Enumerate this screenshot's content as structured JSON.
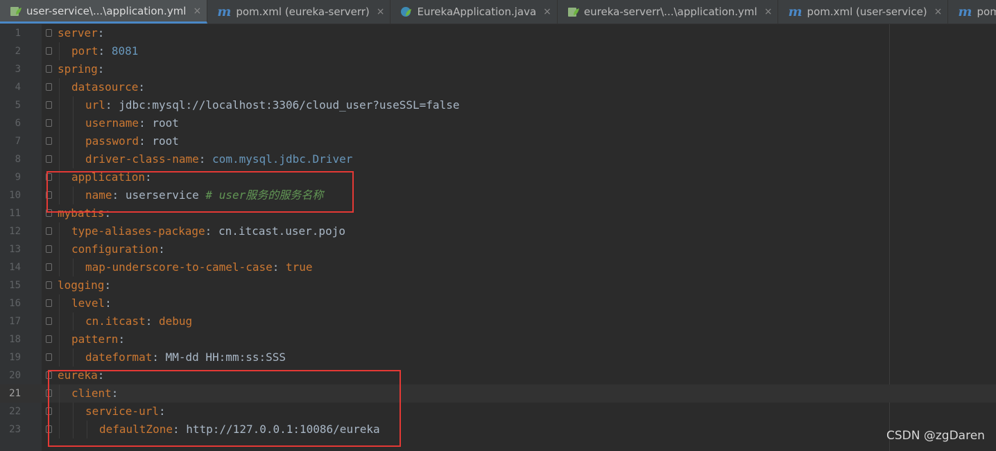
{
  "tabs": [
    {
      "label": "user-service\\...\\application.yml",
      "icon": "spring-yaml-icon",
      "active": true
    },
    {
      "label": "pom.xml (eureka-serverr)",
      "icon": "maven-icon",
      "active": false
    },
    {
      "label": "EurekaApplication.java",
      "icon": "spring-java-icon",
      "active": false
    },
    {
      "label": "eureka-serverr\\...\\application.yml",
      "icon": "spring-yaml-icon",
      "active": false
    },
    {
      "label": "pom.xml (user-service)",
      "icon": "maven-icon",
      "active": false
    },
    {
      "label": "pom.xml (orde",
      "icon": "maven-icon",
      "active": false
    }
  ],
  "maven_glyph": "m",
  "close_glyph": "×",
  "lines": [
    {
      "n": "1",
      "indent": 0,
      "key": "server",
      "val": "",
      "type": ""
    },
    {
      "n": "2",
      "indent": 1,
      "key": "port",
      "val": "8081",
      "type": "num"
    },
    {
      "n": "3",
      "indent": 0,
      "key": "spring",
      "val": "",
      "type": ""
    },
    {
      "n": "4",
      "indent": 1,
      "key": "datasource",
      "val": "",
      "type": ""
    },
    {
      "n": "5",
      "indent": 2,
      "key": "url",
      "val": "jdbc:mysql://localhost:3306/cloud_user?useSSL=false",
      "type": "str"
    },
    {
      "n": "6",
      "indent": 2,
      "key": "username",
      "val": "root",
      "type": "str"
    },
    {
      "n": "7",
      "indent": 2,
      "key": "password",
      "val": "root",
      "type": "str"
    },
    {
      "n": "8",
      "indent": 2,
      "key": "driver-class-name",
      "val": "com.mysql.jdbc.Driver",
      "type": "cls"
    },
    {
      "n": "9",
      "indent": 1,
      "key": "application",
      "val": "",
      "type": ""
    },
    {
      "n": "10",
      "indent": 2,
      "key": "name",
      "val": "userservice",
      "type": "str",
      "comment": "# user服务的服务名称"
    },
    {
      "n": "11",
      "indent": 0,
      "key": "mybatis",
      "val": "",
      "type": ""
    },
    {
      "n": "12",
      "indent": 1,
      "key": "type-aliases-package",
      "val": "cn.itcast.user.pojo",
      "type": "str"
    },
    {
      "n": "13",
      "indent": 1,
      "key": "configuration",
      "val": "",
      "type": ""
    },
    {
      "n": "14",
      "indent": 2,
      "key": "map-underscore-to-camel-case",
      "val": "true",
      "type": "kw"
    },
    {
      "n": "15",
      "indent": 0,
      "key": "logging",
      "val": "",
      "type": ""
    },
    {
      "n": "16",
      "indent": 1,
      "key": "level",
      "val": "",
      "type": ""
    },
    {
      "n": "17",
      "indent": 2,
      "key": "cn.itcast",
      "val": "debug",
      "type": "kw"
    },
    {
      "n": "18",
      "indent": 1,
      "key": "pattern",
      "val": "",
      "type": ""
    },
    {
      "n": "19",
      "indent": 2,
      "key": "dateformat",
      "val": "MM-dd HH:mm:ss:SSS",
      "type": "str"
    },
    {
      "n": "20",
      "indent": 0,
      "key": "eureka",
      "val": "",
      "type": ""
    },
    {
      "n": "21",
      "indent": 1,
      "key": "client",
      "val": "",
      "type": ""
    },
    {
      "n": "22",
      "indent": 2,
      "key": "service-url",
      "val": "",
      "type": ""
    },
    {
      "n": "23",
      "indent": 3,
      "key": "defaultZone",
      "val": "http://127.0.0.1:10086/eureka",
      "type": "str"
    }
  ],
  "current_line": "21",
  "watermark": "CSDN @zgDaren",
  "colors": {
    "background": "#2b2b2b",
    "key": "#cc7832",
    "plain": "#a9b7c6",
    "number": "#6897bb",
    "comment": "#629755",
    "highlight_box": "#e53935",
    "active_tab_underline": "#4a88c7"
  }
}
